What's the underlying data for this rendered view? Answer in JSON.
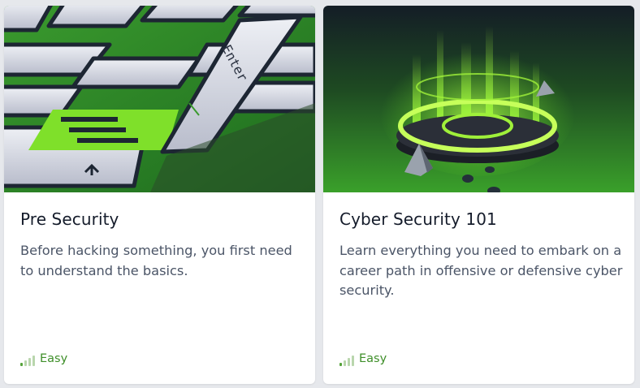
{
  "cards": [
    {
      "title": "Pre Security",
      "description": "Before hacking something, you first need to understand the basics.",
      "difficulty": "Easy",
      "difficulty_level": 1,
      "difficulty_max": 4,
      "image_key_text": "Enter"
    },
    {
      "title": "Cyber Security 101",
      "description": "Learn everything you need to embark on a career path in offensive or defensive cyber security.",
      "difficulty": "Easy",
      "difficulty_level": 1,
      "difficulty_max": 4
    }
  ],
  "colors": {
    "accent_green": "#55a33a",
    "title_text": "#151c2b",
    "body_text": "#4b5567",
    "card_bg": "#ffffff",
    "page_bg": "#e6e8ec"
  }
}
